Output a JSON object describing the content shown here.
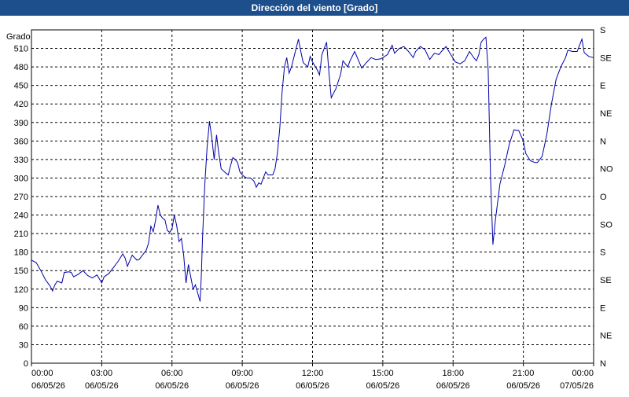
{
  "title": "Dirección del viento [Grado]",
  "colors": {
    "titlebar": "#1d4f8c",
    "series": "#0000aa",
    "grid": "#000000"
  },
  "chart_data": {
    "type": "line",
    "title": "Dirección del viento [Grado]",
    "ylabel": "Grado",
    "ylim": [
      0,
      540
    ],
    "yticks": [
      0,
      30,
      60,
      90,
      120,
      150,
      180,
      210,
      240,
      270,
      300,
      330,
      360,
      390,
      420,
      450,
      480,
      510
    ],
    "right_axis_labels": [
      "N",
      "NE",
      "E",
      "SE",
      "S",
      "SO",
      "O",
      "NO",
      "N",
      "NE",
      "E",
      "SE",
      "S"
    ],
    "xlim": [
      0,
      24
    ],
    "xticks": [
      {
        "x": 0,
        "time": "00:00",
        "date": "06/05/26"
      },
      {
        "x": 3,
        "time": "03:00",
        "date": "06/05/26"
      },
      {
        "x": 6,
        "time": "06:00",
        "date": "06/05/26"
      },
      {
        "x": 9,
        "time": "09:00",
        "date": "06/05/26"
      },
      {
        "x": 12,
        "time": "12:00",
        "date": "06/05/26"
      },
      {
        "x": 15,
        "time": "15:00",
        "date": "06/05/26"
      },
      {
        "x": 18,
        "time": "18:00",
        "date": "06/05/26"
      },
      {
        "x": 21,
        "time": "21:00",
        "date": "06/05/26"
      },
      {
        "x": 24,
        "time": "00:00",
        "date": "07/05/26"
      }
    ],
    "grid": true,
    "series": [
      {
        "points": [
          [
            0.0,
            167
          ],
          [
            0.2,
            163
          ],
          [
            0.4,
            150
          ],
          [
            0.6,
            135
          ],
          [
            0.8,
            125
          ],
          [
            0.9,
            117
          ],
          [
            1.0,
            127
          ],
          [
            1.1,
            133
          ],
          [
            1.3,
            130
          ],
          [
            1.4,
            147
          ],
          [
            1.6,
            148
          ],
          [
            1.7,
            147
          ],
          [
            1.8,
            140
          ],
          [
            2.0,
            144
          ],
          [
            2.2,
            150
          ],
          [
            2.4,
            142
          ],
          [
            2.6,
            138
          ],
          [
            2.8,
            143
          ],
          [
            3.0,
            130
          ],
          [
            3.1,
            140
          ],
          [
            3.3,
            145
          ],
          [
            3.5,
            155
          ],
          [
            3.7,
            165
          ],
          [
            3.9,
            177
          ],
          [
            4.0,
            170
          ],
          [
            4.1,
            157
          ],
          [
            4.3,
            175
          ],
          [
            4.5,
            167
          ],
          [
            4.6,
            168
          ],
          [
            4.8,
            178
          ],
          [
            4.9,
            183
          ],
          [
            5.0,
            195
          ],
          [
            5.1,
            222
          ],
          [
            5.2,
            213
          ],
          [
            5.3,
            232
          ],
          [
            5.4,
            256
          ],
          [
            5.5,
            240
          ],
          [
            5.6,
            235
          ],
          [
            5.7,
            232
          ],
          [
            5.8,
            215
          ],
          [
            5.9,
            212
          ],
          [
            6.0,
            218
          ],
          [
            6.1,
            240
          ],
          [
            6.2,
            223
          ],
          [
            6.3,
            197
          ],
          [
            6.4,
            202
          ],
          [
            6.5,
            175
          ],
          [
            6.6,
            130
          ],
          [
            6.7,
            160
          ],
          [
            6.8,
            140
          ],
          [
            6.9,
            120
          ],
          [
            7.0,
            127
          ],
          [
            7.2,
            100
          ],
          [
            7.25,
            140
          ],
          [
            7.3,
            200
          ],
          [
            7.4,
            290
          ],
          [
            7.5,
            350
          ],
          [
            7.6,
            392
          ],
          [
            7.7,
            365
          ],
          [
            7.8,
            330
          ],
          [
            7.9,
            370
          ],
          [
            8.0,
            340
          ],
          [
            8.1,
            315
          ],
          [
            8.3,
            308
          ],
          [
            8.4,
            305
          ],
          [
            8.5,
            320
          ],
          [
            8.6,
            333
          ],
          [
            8.7,
            330
          ],
          [
            8.8,
            325
          ],
          [
            8.9,
            310
          ],
          [
            9.0,
            305
          ],
          [
            9.1,
            302
          ],
          [
            9.2,
            300
          ],
          [
            9.35,
            300
          ],
          [
            9.5,
            295
          ],
          [
            9.6,
            285
          ],
          [
            9.7,
            292
          ],
          [
            9.8,
            290
          ],
          [
            9.9,
            300
          ],
          [
            10.0,
            310
          ],
          [
            10.1,
            305
          ],
          [
            10.3,
            305
          ],
          [
            10.4,
            315
          ],
          [
            10.5,
            340
          ],
          [
            10.6,
            380
          ],
          [
            10.7,
            440
          ],
          [
            10.8,
            480
          ],
          [
            10.9,
            495
          ],
          [
            11.0,
            470
          ],
          [
            11.1,
            480
          ],
          [
            11.3,
            510
          ],
          [
            11.4,
            525
          ],
          [
            11.5,
            505
          ],
          [
            11.6,
            487
          ],
          [
            11.8,
            480
          ],
          [
            11.9,
            497
          ],
          [
            12.0,
            488
          ],
          [
            12.2,
            475
          ],
          [
            12.3,
            467
          ],
          [
            12.4,
            500
          ],
          [
            12.6,
            520
          ],
          [
            12.7,
            470
          ],
          [
            12.8,
            430
          ],
          [
            13.0,
            445
          ],
          [
            13.2,
            468
          ],
          [
            13.3,
            490
          ],
          [
            13.5,
            480
          ],
          [
            13.6,
            490
          ],
          [
            13.8,
            505
          ],
          [
            14.0,
            487
          ],
          [
            14.1,
            478
          ],
          [
            14.3,
            487
          ],
          [
            14.5,
            495
          ],
          [
            14.7,
            492
          ],
          [
            14.9,
            493
          ],
          [
            15.0,
            495
          ],
          [
            15.2,
            500
          ],
          [
            15.4,
            515
          ],
          [
            15.5,
            502
          ],
          [
            15.7,
            510
          ],
          [
            15.9,
            513
          ],
          [
            16.1,
            505
          ],
          [
            16.3,
            495
          ],
          [
            16.4,
            505
          ],
          [
            16.6,
            513
          ],
          [
            16.8,
            508
          ],
          [
            17.0,
            492
          ],
          [
            17.2,
            502
          ],
          [
            17.4,
            500
          ],
          [
            17.5,
            505
          ],
          [
            17.7,
            513
          ],
          [
            17.9,
            500
          ],
          [
            18.1,
            488
          ],
          [
            18.3,
            485
          ],
          [
            18.5,
            490
          ],
          [
            18.7,
            505
          ],
          [
            18.9,
            494
          ],
          [
            19.0,
            490
          ],
          [
            19.1,
            500
          ],
          [
            19.2,
            520
          ],
          [
            19.3,
            525
          ],
          [
            19.4,
            528
          ],
          [
            19.5,
            475
          ],
          [
            19.6,
            300
          ],
          [
            19.7,
            192
          ],
          [
            19.8,
            230
          ],
          [
            20.0,
            290
          ],
          [
            20.2,
            320
          ],
          [
            20.4,
            355
          ],
          [
            20.6,
            378
          ],
          [
            20.8,
            377
          ],
          [
            21.0,
            360
          ],
          [
            21.1,
            340
          ],
          [
            21.3,
            328
          ],
          [
            21.5,
            325
          ],
          [
            21.6,
            325
          ],
          [
            21.8,
            335
          ],
          [
            22.0,
            370
          ],
          [
            22.2,
            420
          ],
          [
            22.4,
            460
          ],
          [
            22.6,
            480
          ],
          [
            22.8,
            495
          ],
          [
            22.9,
            507
          ],
          [
            23.1,
            505
          ],
          [
            23.3,
            505
          ],
          [
            23.5,
            525
          ],
          [
            23.6,
            503
          ],
          [
            23.8,
            497
          ],
          [
            24.0,
            495
          ]
        ]
      }
    ]
  }
}
